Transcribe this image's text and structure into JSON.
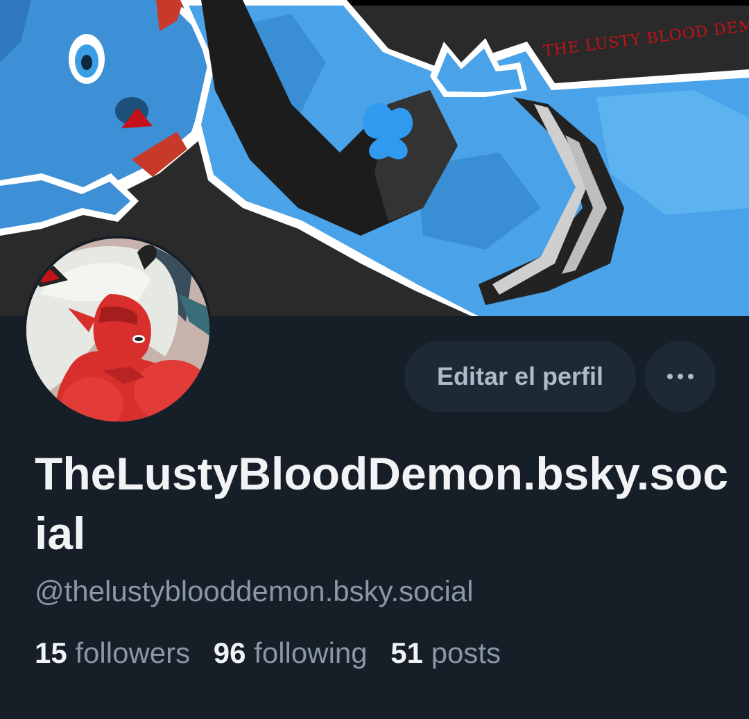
{
  "banner": {
    "watermark_text": "THE LUSTY BLOOD DEMON",
    "watermark_color": "#c3121a"
  },
  "avatar": {
    "skin_color": "#d92f2c",
    "hair_color": "#e8ebe6"
  },
  "profile": {
    "display_name": "TheLustyBloodDemon.bsky.social",
    "handle": "@thelustyblooddemon.bsky.social"
  },
  "actions": {
    "edit_label": "Editar el perfil",
    "more_icon": "ellipsis-icon"
  },
  "stats": {
    "followers_count": "15",
    "followers_label": "followers",
    "following_count": "96",
    "following_label": "following",
    "posts_count": "51",
    "posts_label": "posts"
  },
  "colors": {
    "background": "#161e27",
    "button_bg": "#1e2936",
    "text_primary": "#f1f3f5",
    "text_secondary": "#8a97a6"
  }
}
